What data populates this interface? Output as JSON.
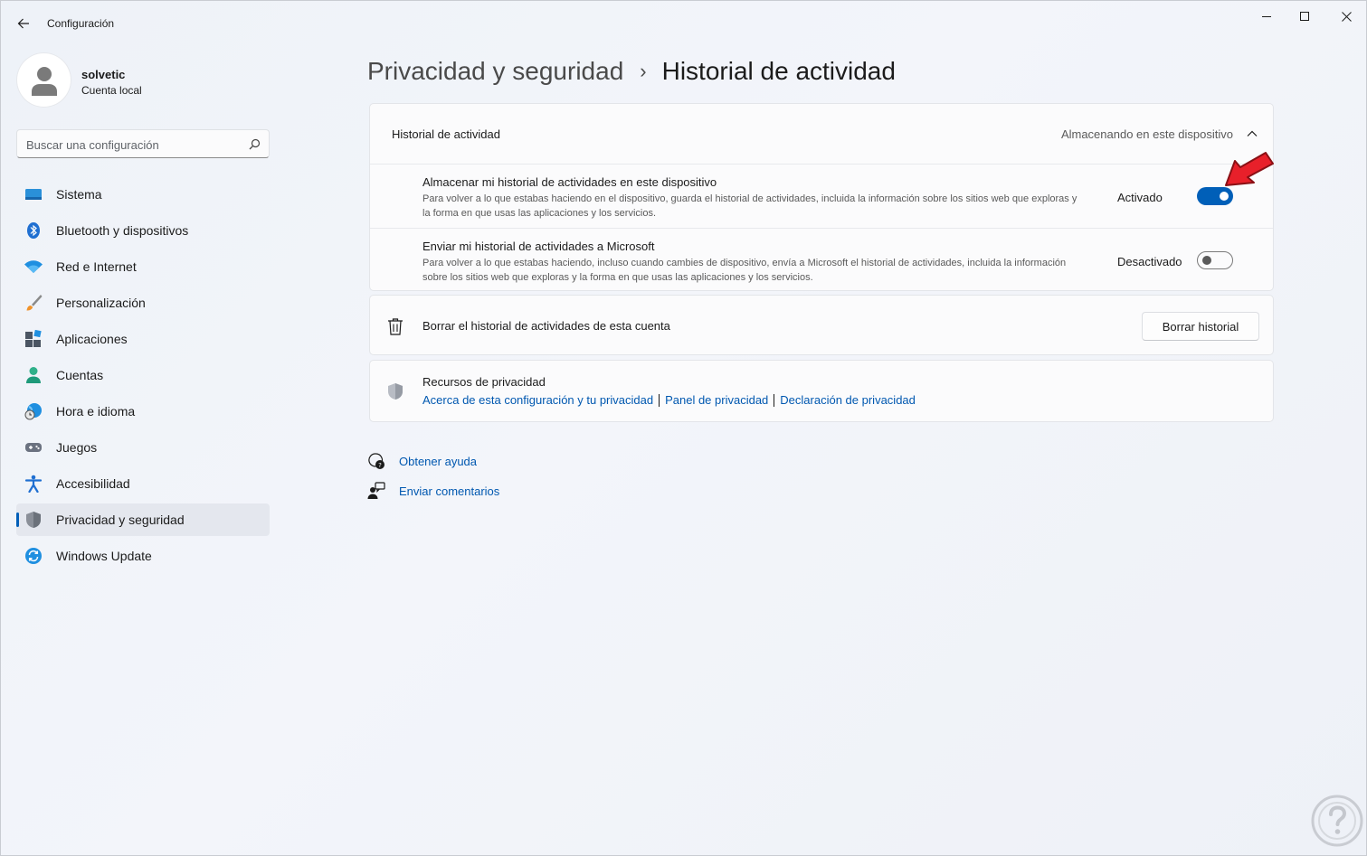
{
  "window": {
    "app_title": "Configuración"
  },
  "profile": {
    "name": "solvetic",
    "account_type": "Cuenta local"
  },
  "search": {
    "placeholder": "Buscar una configuración"
  },
  "sidebar": {
    "items": [
      {
        "label": "Sistema",
        "icon": "monitor-icon",
        "active": false
      },
      {
        "label": "Bluetooth y dispositivos",
        "icon": "bluetooth-icon",
        "active": false
      },
      {
        "label": "Red e Internet",
        "icon": "wifi-icon",
        "active": false
      },
      {
        "label": "Personalización",
        "icon": "brush-icon",
        "active": false
      },
      {
        "label": "Aplicaciones",
        "icon": "apps-icon",
        "active": false
      },
      {
        "label": "Cuentas",
        "icon": "person-icon",
        "active": false
      },
      {
        "label": "Hora e idioma",
        "icon": "globe-clock-icon",
        "active": false
      },
      {
        "label": "Juegos",
        "icon": "gamepad-icon",
        "active": false
      },
      {
        "label": "Accesibilidad",
        "icon": "accessibility-icon",
        "active": false
      },
      {
        "label": "Privacidad y seguridad",
        "icon": "shield-icon",
        "active": true
      },
      {
        "label": "Windows Update",
        "icon": "update-icon",
        "active": false
      }
    ]
  },
  "breadcrumb": {
    "parent": "Privacidad y seguridad",
    "separator": "›",
    "current": "Historial de actividad"
  },
  "activity": {
    "title": "Historial de actividad",
    "status": "Almacenando en este dispositivo",
    "expanded": true,
    "rows": [
      {
        "title": "Almacenar mi historial de actividades en este dispositivo",
        "description": "Para volver a lo que estabas haciendo en el dispositivo, guarda el historial de actividades, incluida la información sobre los sitios web que exploras y la forma en que usas las aplicaciones y los servicios.",
        "state_label": "Activado",
        "on": true
      },
      {
        "title": "Enviar mi historial de actividades a Microsoft",
        "description": "Para volver a lo que estabas haciendo, incluso cuando cambies de dispositivo, envía a Microsoft el historial de actividades, incluida la información sobre los sitios web que exploras y la forma en que usas las aplicaciones y los servicios.",
        "state_label": "Desactivado",
        "on": false
      }
    ]
  },
  "clear_history": {
    "label": "Borrar el historial de actividades de esta cuenta",
    "button": "Borrar historial",
    "icon": "trash-icon"
  },
  "resources": {
    "title": "Recursos de privacidad",
    "icon": "shield-icon",
    "links": [
      "Acerca de esta configuración y tu privacidad",
      "Panel de privacidad",
      "Declaración de privacidad"
    ]
  },
  "help": {
    "get_help": "Obtener ayuda",
    "feedback": "Enviar comentarios"
  },
  "colors": {
    "accent": "#005fb8",
    "link": "#0058b0",
    "annotation_arrow": "#e8202a"
  }
}
